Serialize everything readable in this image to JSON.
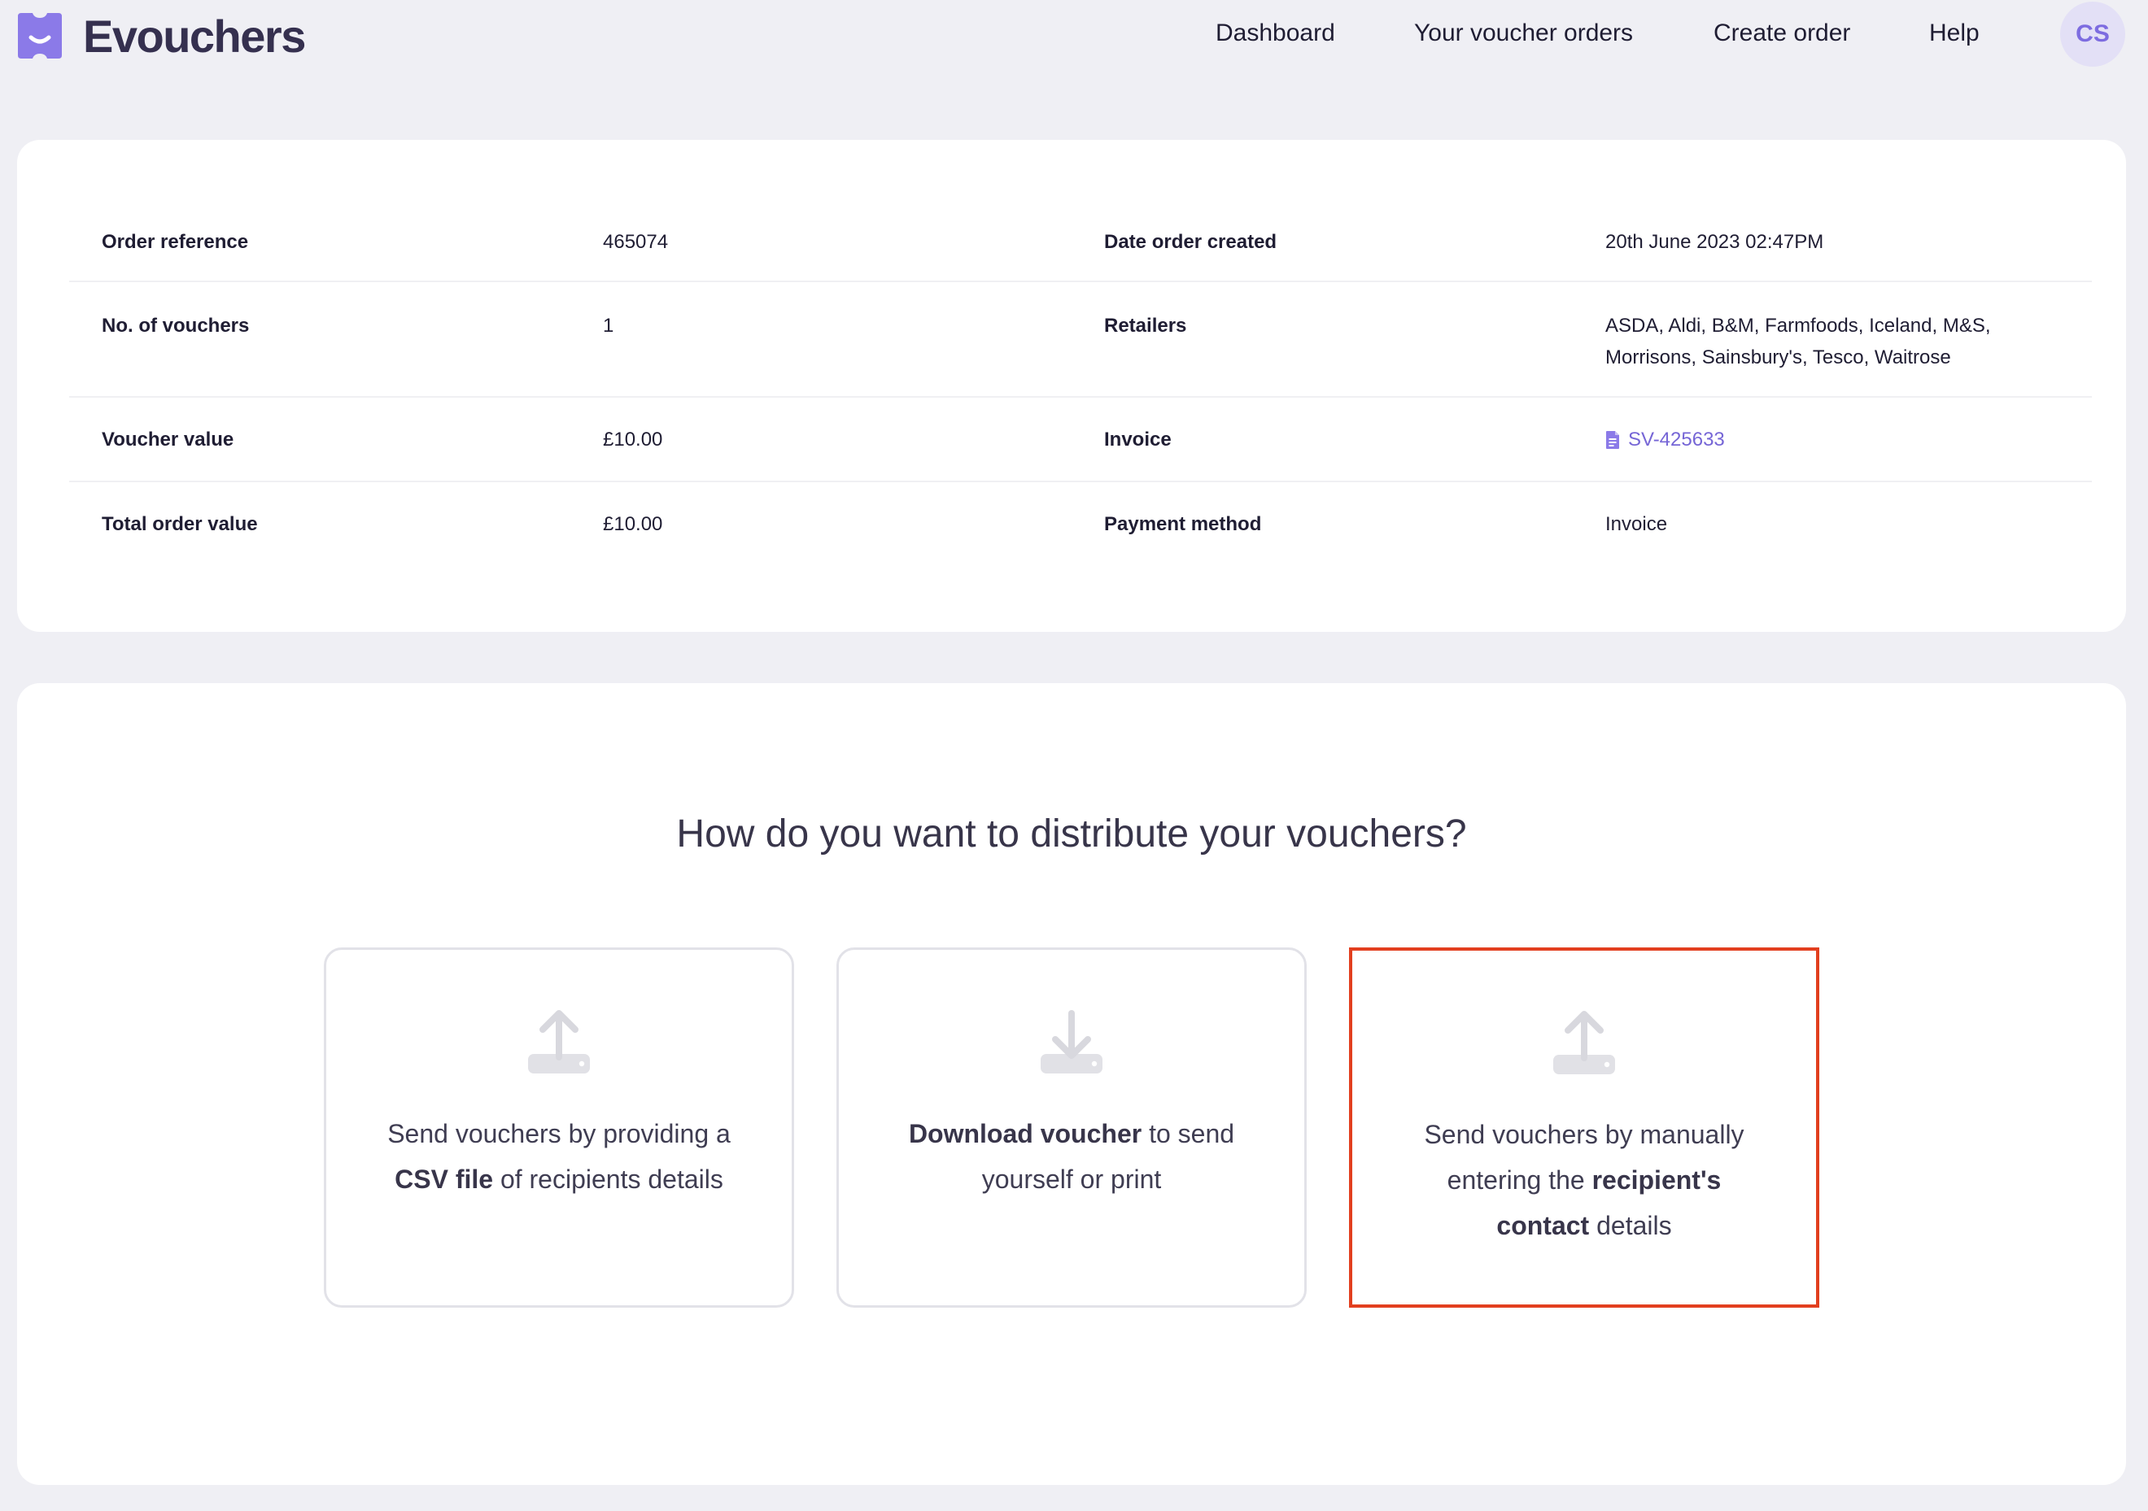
{
  "brand": {
    "name": "Evouchers"
  },
  "nav": {
    "dashboard": "Dashboard",
    "orders": "Your voucher orders",
    "create": "Create order",
    "help": "Help",
    "avatar_initials": "CS"
  },
  "order": {
    "rows": [
      {
        "label1": "Order reference",
        "value1": "465074",
        "label2": "Date order created",
        "value2": "20th June 2023 02:47PM"
      },
      {
        "label1": "No. of vouchers",
        "value1": "1",
        "label2": "Retailers",
        "value2": "ASDA, Aldi, B&M, Farmfoods, Iceland, M&S, Morrisons, Sainsbury's, Tesco, Waitrose"
      },
      {
        "label1": "Voucher value",
        "value1": "£10.00",
        "label2": "Invoice",
        "value2": "SV-425633"
      },
      {
        "label1": "Total order value",
        "value1": "£10.00",
        "label2": "Payment method",
        "value2": "Invoice"
      }
    ]
  },
  "distribute": {
    "title": "How do you want to distribute your vouchers?",
    "options": [
      {
        "icon": "upload-icon",
        "pre": "Send vouchers by providing a ",
        "bold": "CSV file",
        "post": " of recipients details",
        "selected": false
      },
      {
        "icon": "download-icon",
        "bold": "Download voucher",
        "post": " to send yourself or print",
        "selected": false
      },
      {
        "icon": "upload-icon",
        "pre": "Send vouchers by manually entering the ",
        "bold": "recipient's contact",
        "post": " details",
        "selected": true
      }
    ]
  },
  "colors": {
    "background": "#efeff4",
    "brand": "#7d6ce0",
    "link": "#7666d6",
    "selected_border": "#e23f1f"
  }
}
